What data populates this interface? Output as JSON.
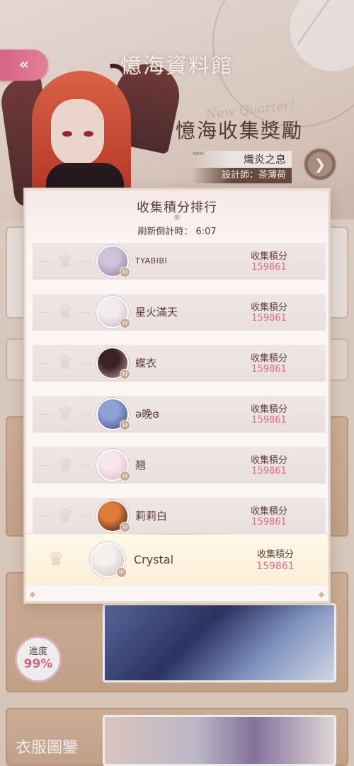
{
  "header": {
    "back_icon": "double-chevron-left",
    "title": "憶海資料館",
    "reward_title": "憶海收集獎勵",
    "reward_ghost": "New Quarter!",
    "suit_tag": "NIKKI",
    "suit_name": "熾炎之息",
    "designer": "設計師：茶薄荷",
    "next_icon": "chevron-right"
  },
  "progress": {
    "label": "進度",
    "value": "99%"
  },
  "gallery": {
    "title": "衣服圖鑒"
  },
  "ranking": {
    "title": "收集積分排行",
    "ornament": "❋",
    "countdown": "刷新倒計時： 6:07",
    "score_label": "收集積分",
    "badge_text": "III",
    "crown_icon": "crown-icon",
    "colors": {
      "score": "#e06a8a",
      "accent": "#e56a8e"
    },
    "rows": [
      {
        "name": "TYABIBI",
        "score": "159861",
        "avatar_colors": [
          "#cfc3d8",
          "#8c7ba6"
        ]
      },
      {
        "name": "星火滿天",
        "score": "159861",
        "avatar_colors": [
          "#f2ecef",
          "#c9b3bf"
        ]
      },
      {
        "name": "蝶衣",
        "score": "159861",
        "avatar_colors": [
          "#3b2226",
          "#c9a0a4"
        ]
      },
      {
        "name": "ə晚ɞ",
        "score": "159861",
        "avatar_colors": [
          "#8fa0d6",
          "#3d4a80"
        ]
      },
      {
        "name": "翘",
        "score": "159861",
        "avatar_colors": [
          "#f7e6ea",
          "#d9b7c0"
        ]
      },
      {
        "name": "莉莉白",
        "score": "159861",
        "avatar_colors": [
          "#e07a3a",
          "#2b1b22"
        ]
      }
    ],
    "self": {
      "name": "Crystal",
      "score": "159861",
      "avatar_colors": [
        "#f4f0ec",
        "#c7bcb4"
      ]
    }
  }
}
